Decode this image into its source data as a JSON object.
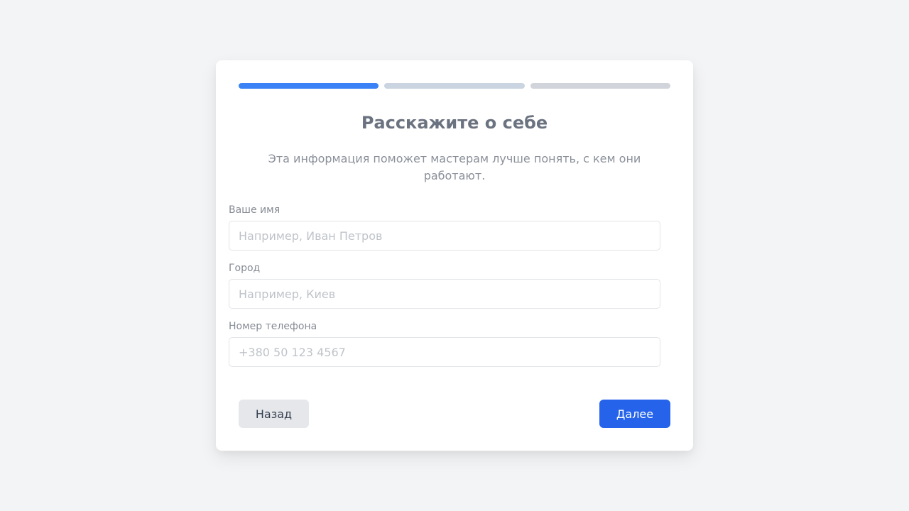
{
  "progress": {
    "steps_total": 3,
    "current_step": 1,
    "colors": [
      "#3b82f6",
      "#cbd5e1",
      "#d1d5db"
    ]
  },
  "form": {
    "title": "Расскажите о себе",
    "subtitle": "Эта информация поможет мастерам лучше понять, с кем они работают.",
    "fields": {
      "name": {
        "label": "Ваше имя",
        "placeholder": "Например, Иван Петров",
        "value": ""
      },
      "city": {
        "label": "Город",
        "placeholder": "Например, Киев",
        "value": ""
      },
      "phone": {
        "label": "Номер телефона",
        "placeholder": "+380 50 123 4567",
        "value": ""
      }
    }
  },
  "buttons": {
    "back_label": "Назад",
    "next_label": "Далее",
    "next_color": "#2563eb"
  }
}
